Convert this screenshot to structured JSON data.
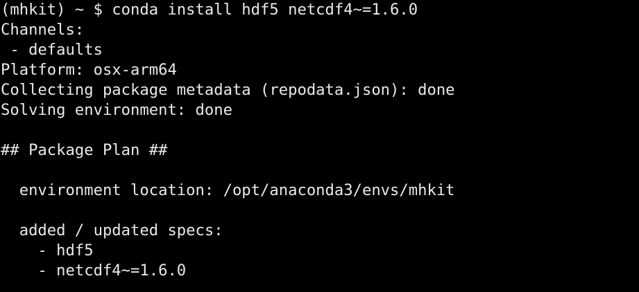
{
  "terminal": {
    "lines": [
      "(mhkit) ~ $ conda install hdf5 netcdf4~=1.6.0",
      "Channels:",
      " - defaults",
      "Platform: osx-arm64",
      "Collecting package metadata (repodata.json): done",
      "Solving environment: done",
      "",
      "## Package Plan ##",
      "",
      "  environment location: /opt/anaconda3/envs/mhkit",
      "",
      "  added / updated specs:",
      "    - hdf5",
      "    - netcdf4~=1.6.0"
    ],
    "colors": {
      "background": "#000000",
      "foreground": "#e9e9e9"
    }
  }
}
